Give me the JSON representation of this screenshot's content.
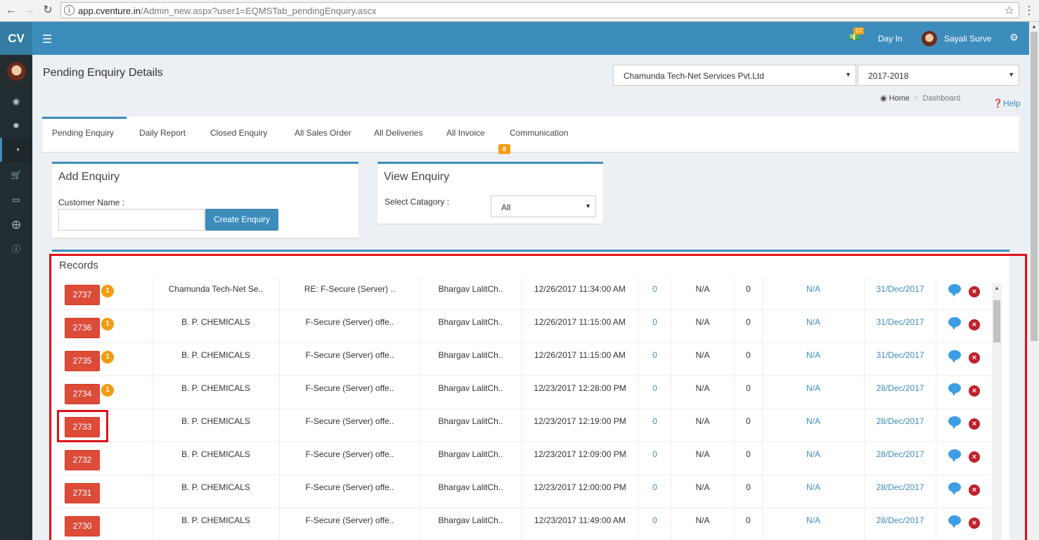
{
  "browser": {
    "url_host": "app.cventure.in",
    "url_path": "/Admin_new.aspx?user1=EQMSTab_pendingEnquiry.ascx"
  },
  "header": {
    "logo": "CV",
    "notification_count": "12",
    "day_in_label": "Day In",
    "user_name": "Sayali Surve"
  },
  "page": {
    "title": "Pending Enquiry Details",
    "company_select": "Chamunda Tech-Net Services Pvt.Ltd",
    "year_select": "2017-2018",
    "breadcrumb_home": "Home",
    "breadcrumb_current": "Dashboard",
    "help_label": "Help"
  },
  "tabs": [
    {
      "label": "Pending Enquiry"
    },
    {
      "label": "Daily Report"
    },
    {
      "label": "Closed Enquiry"
    },
    {
      "label": "All Sales Order"
    },
    {
      "label": "All Deliveries"
    },
    {
      "label": "All Invoice"
    },
    {
      "label": "Communication",
      "badge": "8"
    }
  ],
  "add_enquiry": {
    "title": "Add Enquiry",
    "customer_label": "Customer Name :",
    "customer_value": "",
    "create_button": "Create Enquiry"
  },
  "view_enquiry": {
    "title": "View Enquiry",
    "category_label": "Select Catagory :",
    "category_value": "All"
  },
  "records": {
    "title": "Records",
    "rows": [
      {
        "id": "2737",
        "count": "1",
        "customer": "Chamunda Tech-Net Se..",
        "subject": "RE: F-Secure (Server) ..",
        "person": "Bhargav LalitCh..",
        "datetime": "12/26/2017 11:34:00 AM",
        "c1": "0",
        "c2": "N/A",
        "c3": "0",
        "c4": "N/A",
        "date": "31/Dec/2017"
      },
      {
        "id": "2736",
        "count": "1",
        "customer": "B. P. CHEMICALS",
        "subject": "F-Secure (Server) offe..",
        "person": "Bhargav LalitCh..",
        "datetime": "12/26/2017 11:15:00 AM",
        "c1": "0",
        "c2": "N/A",
        "c3": "0",
        "c4": "N/A",
        "date": "31/Dec/2017"
      },
      {
        "id": "2735",
        "count": "1",
        "customer": "B. P. CHEMICALS",
        "subject": "F-Secure (Server) offe..",
        "person": "Bhargav LalitCh..",
        "datetime": "12/26/2017 11:15:00 AM",
        "c1": "0",
        "c2": "N/A",
        "c3": "0",
        "c4": "N/A",
        "date": "31/Dec/2017"
      },
      {
        "id": "2734",
        "count": "1",
        "customer": "B. P. CHEMICALS",
        "subject": "F-Secure (Server) offe..",
        "person": "Bhargav LalitCh..",
        "datetime": "12/23/2017 12:28:00 PM",
        "c1": "0",
        "c2": "N/A",
        "c3": "0",
        "c4": "N/A",
        "date": "28/Dec/2017"
      },
      {
        "id": "2733",
        "count": "",
        "customer": "B. P. CHEMICALS",
        "subject": "F-Secure (Server) offe..",
        "person": "Bhargav LalitCh..",
        "datetime": "12/23/2017 12:19:00 PM",
        "c1": "0",
        "c2": "N/A",
        "c3": "0",
        "c4": "N/A",
        "date": "28/Dec/2017"
      },
      {
        "id": "2732",
        "count": "",
        "customer": "B. P. CHEMICALS",
        "subject": "F-Secure (Server) offe..",
        "person": "Bhargav LalitCh..",
        "datetime": "12/23/2017 12:09:00 PM",
        "c1": "0",
        "c2": "N/A",
        "c3": "0",
        "c4": "N/A",
        "date": "28/Dec/2017"
      },
      {
        "id": "2731",
        "count": "",
        "customer": "B. P. CHEMICALS",
        "subject": "F-Secure (Server) offe..",
        "person": "Bhargav LalitCh..",
        "datetime": "12/23/2017 12:00:00 PM",
        "c1": "0",
        "c2": "N/A",
        "c3": "0",
        "c4": "N/A",
        "date": "28/Dec/2017"
      },
      {
        "id": "2730",
        "count": "",
        "customer": "B. P. CHEMICALS",
        "subject": "F-Secure (Server) offe..",
        "person": "Bhargav LalitCh..",
        "datetime": "12/23/2017 11:49:00 AM",
        "c1": "0",
        "c2": "N/A",
        "c3": "0",
        "c4": "N/A",
        "date": "28/Dec/2017"
      }
    ]
  }
}
